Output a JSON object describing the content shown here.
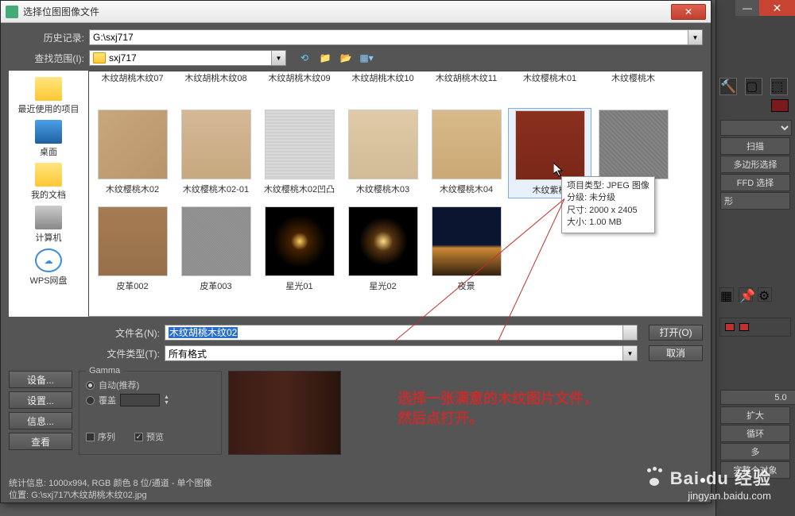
{
  "bg": {
    "btn_scan": "扫描",
    "btn_poly": "多边形选择",
    "btn_ffd": "FFD 选择",
    "section_shape": "形",
    "spin_val": "5.0",
    "btn_expand": "扩大",
    "btn_loop": "循环",
    "btn_more": "多",
    "btn_whole": "完整个对象"
  },
  "dialog": {
    "title": "选择位图图像文件",
    "history_label": "历史记录:",
    "history_value": "G:\\sxj717",
    "lookin_label": "查找范围(I):",
    "lookin_value": "sxj717",
    "places": {
      "recent": "最近使用的项目",
      "desktop": "桌面",
      "mydocs": "我的文档",
      "computer": "计算机",
      "wps": "WPS网盘"
    },
    "trunc_row": [
      "木纹胡桃木纹07",
      "木纹胡桃木纹08",
      "木纹胡桃木纹09",
      "木纹胡桃木纹10",
      "木纹胡桃木纹11",
      "木纹樱桃木01",
      "木纹樱桃木"
    ],
    "files_row1": [
      {
        "name": "木纹樱桃木02",
        "bg": "linear-gradient(135deg,#c9a77c,#b8956a)"
      },
      {
        "name": "木纹樱桃木02-01",
        "bg": "linear-gradient(#d4b896,#c7a97f)"
      },
      {
        "name": "木纹樱桃木02凹凸",
        "bg": "repeating-linear-gradient(0deg,#ddd,#ccc 2px,#ddd 4px)"
      },
      {
        "name": "木纹樱桃木03",
        "bg": "linear-gradient(#e0cba8,#d2bb96)"
      },
      {
        "name": "木纹樱桃木04",
        "bg": "linear-gradient(#d8bb8a,#cba875)"
      },
      {
        "name": "木纹紫檀",
        "bg": "linear-gradient(180deg,#8b2f1f,#7a2818)",
        "selected": true
      },
      {
        "name": "",
        "bg": "repeating-linear-gradient(45deg,#888,#777 2px,#888 4px)"
      }
    ],
    "files_row2": [
      {
        "name": "皮革002",
        "bg": "linear-gradient(#a67c52,#96704a)"
      },
      {
        "name": "皮革003",
        "bg": "repeating-linear-gradient(45deg,#999,#888 1px,#999 2px)"
      },
      {
        "name": "星光01",
        "bg": "radial-gradient(circle,#ffcc66 0%,#442200 18%,#000 55%)"
      },
      {
        "name": "星光02",
        "bg": "radial-gradient(circle,#ffdd88 0%,#553311 20%,#000 50%)"
      },
      {
        "name": "夜景",
        "bg": "linear-gradient(#0a1530 55%,#cc8833 60%,#332211 100%)"
      }
    ],
    "tooltip": {
      "l1": "项目类型: JPEG 图像",
      "l2": "分级: 未分级",
      "l3": "尺寸: 2000 x 2405",
      "l4": "大小: 1.00 MB"
    },
    "filename_label": "文件名(N):",
    "filename_value": "木纹胡桃木纹02",
    "filetype_label": "文件类型(T):",
    "filetype_value": "所有格式",
    "btn_open": "打开(O)",
    "btn_cancel": "取消",
    "btn_device": "设备...",
    "btn_setup": "设置...",
    "btn_info": "信息...",
    "btn_view": "查看",
    "gamma_title": "Gamma",
    "gamma_auto": "自动(推荐)",
    "gamma_override": "覆盖",
    "chk_sequence": "序列",
    "chk_preview": "预览",
    "status1": "统计信息: 1000x994, RGB 颜色 8 位/通道 - 单个图像",
    "status2": "位置: G:\\sxj717\\木纹胡桃木纹02.jpg"
  },
  "annotation": {
    "line1": "选择一张满意的木纹图片文件，",
    "line2": "然后点打开。"
  },
  "watermark": {
    "brand": "Bai",
    "brand2": "du",
    "brand3": "经验",
    "url": "jingyan.baidu.com"
  }
}
